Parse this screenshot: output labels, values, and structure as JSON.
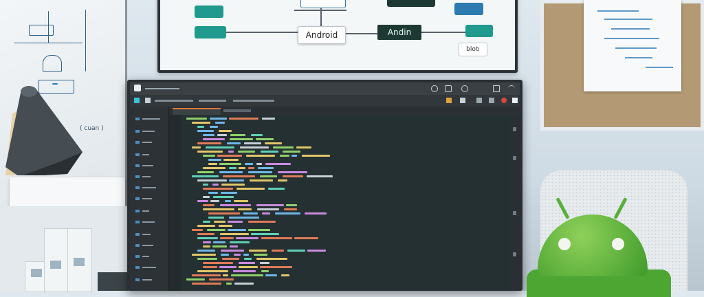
{
  "board_labels": {
    "android": "Android",
    "andin": "Andin",
    "bloti": "blotı",
    "left_sketch": "( cuan )"
  },
  "colors": {
    "android_green": "#4da532",
    "code_bg": "#253032",
    "node_teal": "#1f9a8c",
    "node_blue": "#2b7bb0"
  }
}
